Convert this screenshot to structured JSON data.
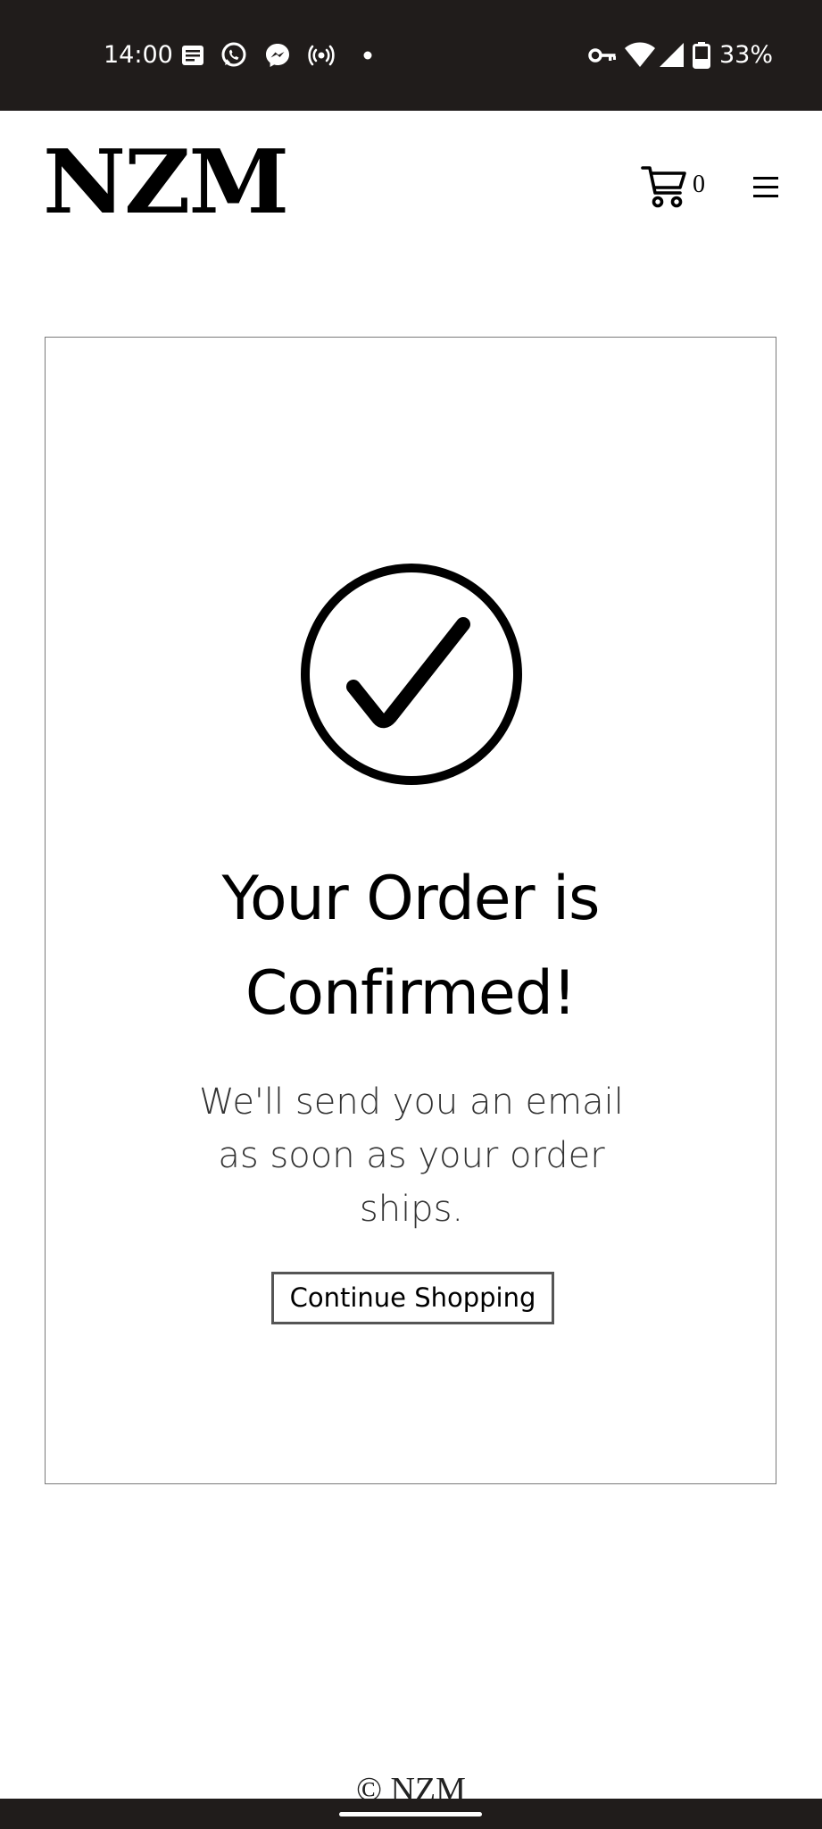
{
  "status_bar": {
    "time": "14:00",
    "notification_icons": [
      "news-icon",
      "whatsapp-icon",
      "messenger-icon",
      "hotspot-icon",
      "dot-icon"
    ],
    "system_icons": [
      "vpn-key-icon",
      "wifi-icon",
      "signal-icon",
      "battery-icon"
    ],
    "battery_level": 0.33,
    "battery_text": "33%"
  },
  "header": {
    "brand": "NZM",
    "cart_count": "0"
  },
  "confirmation": {
    "icon": "check-circle-icon",
    "title_line1": "Your Order is",
    "title_line2": "Confirmed!",
    "message_line1": "We'll send you an email",
    "message_line2": "as soon as your order",
    "message_line3": "ships.",
    "continue_label": "Continue Shopping"
  },
  "footer": {
    "copyright": "© NZM"
  }
}
